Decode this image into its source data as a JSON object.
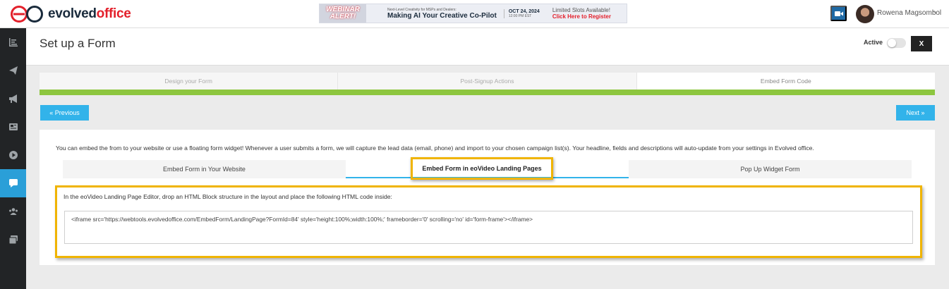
{
  "brand": {
    "name_part1": "evolved",
    "name_part2": "office",
    "accent_color": "#e3202b"
  },
  "banner": {
    "alert_line1": "WEBINAR",
    "alert_line2": "ALERT!",
    "subtitle": "Next-Level Creativity for MSPs and Dealers:",
    "title": "Making AI Your Creative Co-Pilot",
    "date": "OCT 24, 2024",
    "time": "12:00 PM EST",
    "slots": "Limited Slots Available!",
    "cta": "Click Here to Register"
  },
  "user": {
    "name": "Rowena Magsombol"
  },
  "sidebar": {
    "items": [
      {
        "icon": "chart-icon",
        "active": false
      },
      {
        "icon": "paper-plane-icon",
        "active": false
      },
      {
        "icon": "megaphone-icon",
        "active": false
      },
      {
        "icon": "newspaper-icon",
        "active": false
      },
      {
        "icon": "play-icon",
        "active": false
      },
      {
        "icon": "chat-icon",
        "active": true
      },
      {
        "icon": "users-icon",
        "active": false
      },
      {
        "icon": "gallery-icon",
        "active": false
      }
    ],
    "active_color": "#2a9fd8"
  },
  "page": {
    "title": "Set up a Form",
    "active_label": "Active",
    "active_on": false,
    "close_label": "X"
  },
  "steps": [
    "Design your Form",
    "Post-Signup Actions",
    "Embed Form Code"
  ],
  "nav": {
    "prev_label": "« Previous",
    "next_label": "Next »"
  },
  "content": {
    "intro": "You can embed the from to your website or use a floating form widget! Whenever a user submits a form, we will capture the lead data (email, phone) and import to your chosen campaign list(s). Your headline, fields and descriptions will auto-update from your settings in Evolved office.",
    "tabs": [
      "Embed Form in Your Website",
      "Embed Form in eoVideo Landing Pages",
      "Pop Up Widget Form"
    ],
    "active_tab": 1,
    "instruction": "In the eoVideo Landing Page Editor, drop an HTML Block structure in the layout and place the following HTML code inside:",
    "code": "<iframe src='https://webtools.evolvedoffice.com/EmbedForm/LandingPage?FormId=84' style='height:100%;width:100%;' frameborder='0' scrolling='no' id='form-frame'></iframe>"
  },
  "colors": {
    "progress": "#8dc63f",
    "button": "#32b3ea",
    "highlight": "#f0b400"
  }
}
